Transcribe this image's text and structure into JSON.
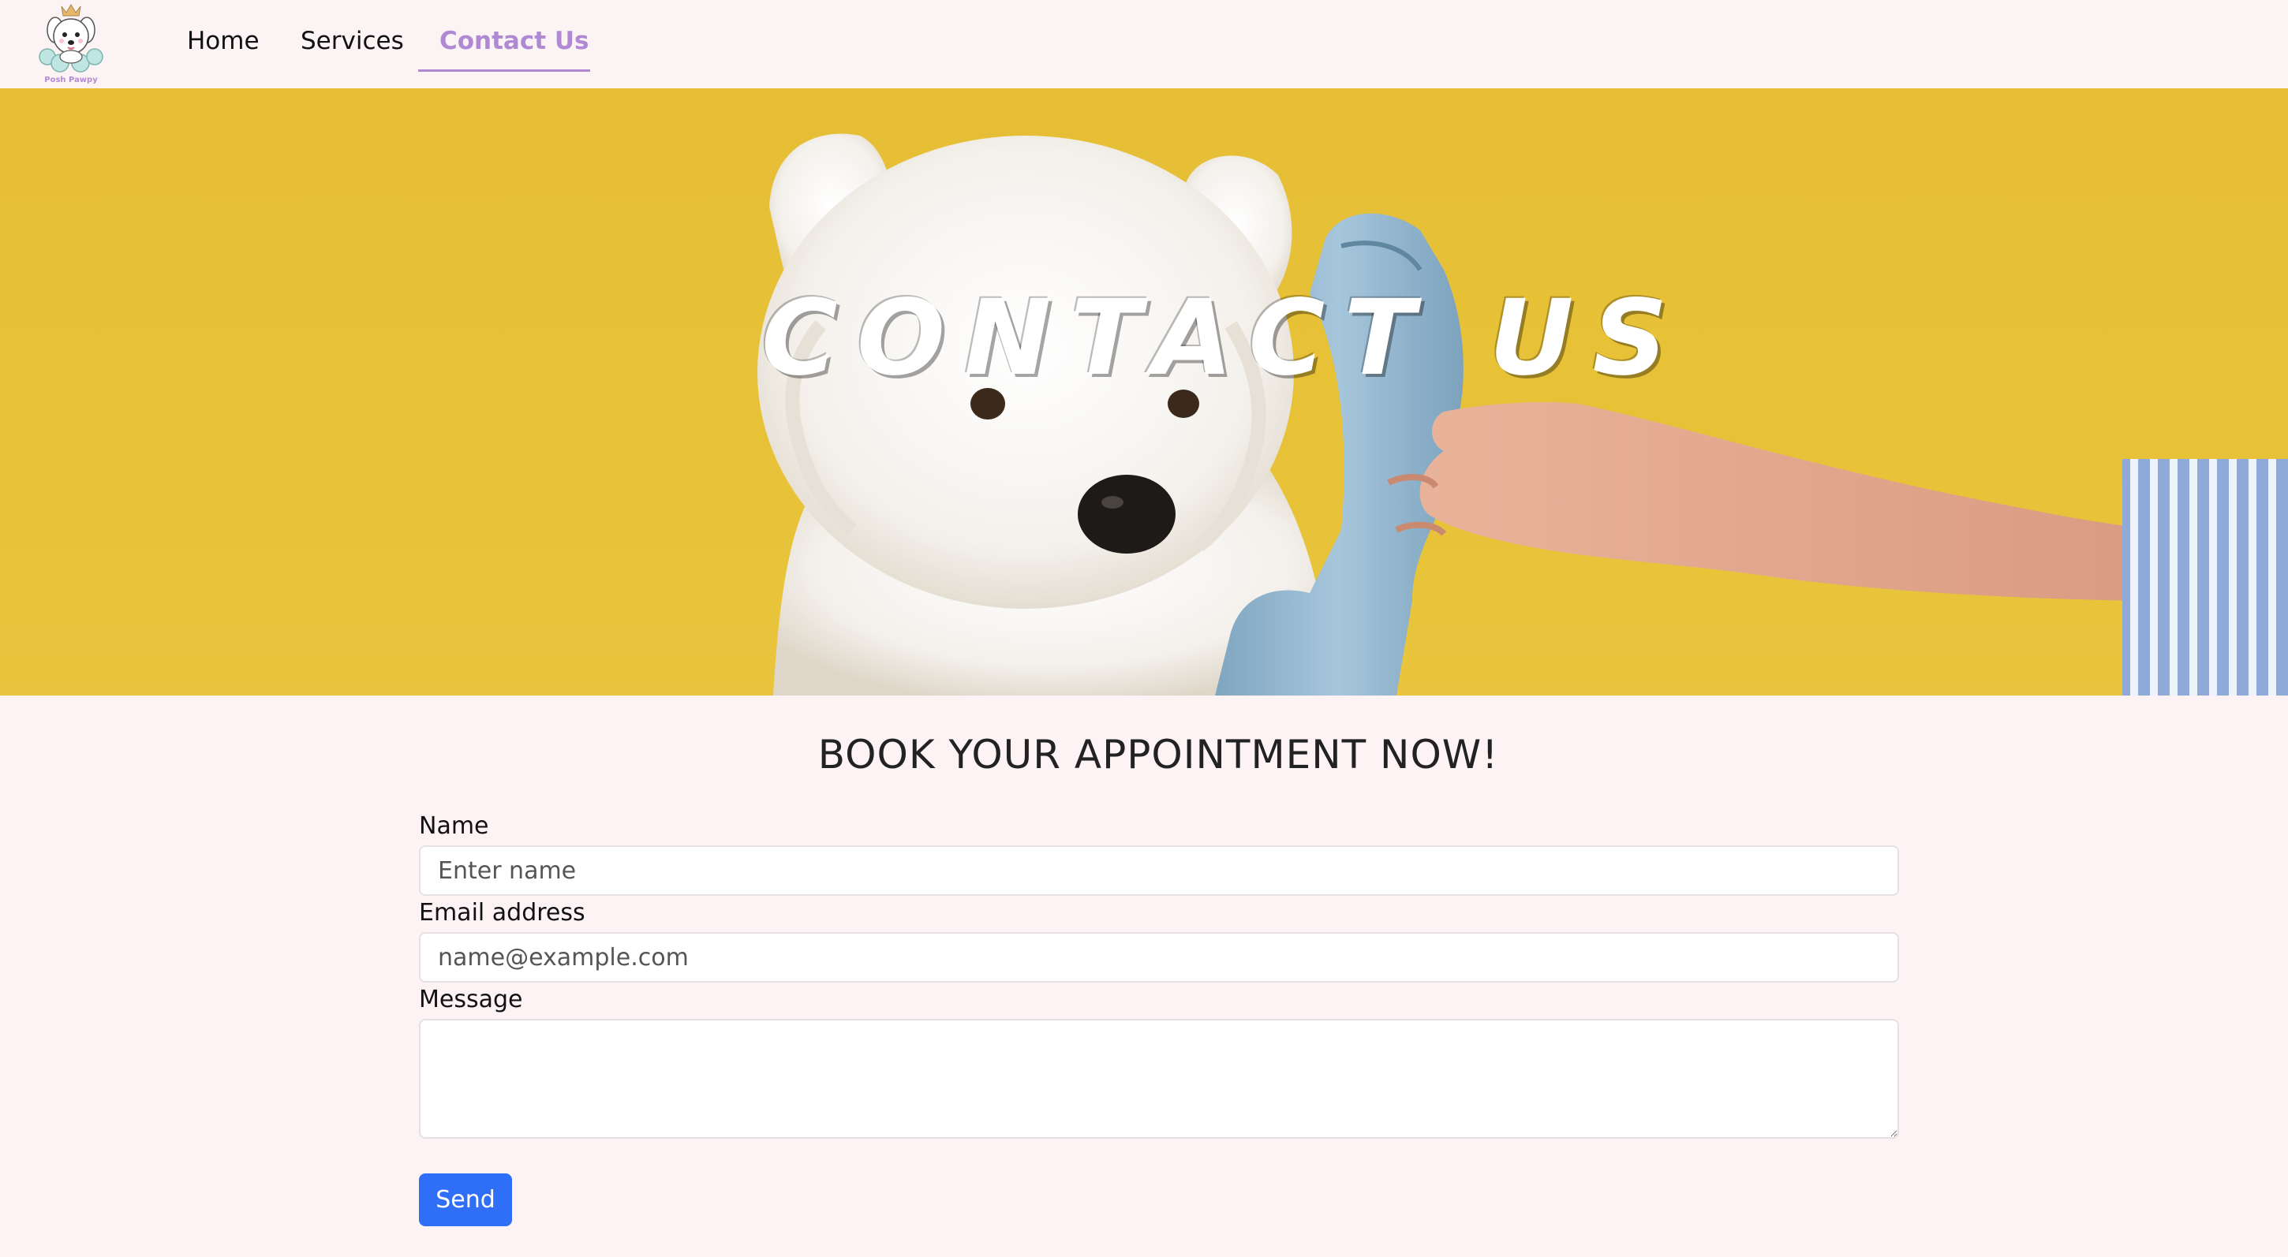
{
  "brand": {
    "logo_text": "Posh Pawpy",
    "accent": "#b089d3"
  },
  "nav": {
    "home": "Home",
    "services": "Services",
    "contact": "Contact Us"
  },
  "hero": {
    "title": "CONTACT US",
    "background": "#e6be35"
  },
  "form": {
    "heading": "BOOK YOUR APPOINTMENT NOW!",
    "name_label": "Name",
    "name_placeholder": "Enter name",
    "email_label": "Email address",
    "email_placeholder": "name@example.com",
    "message_label": "Message",
    "send_label": "Send",
    "button_color": "#2f6ef6"
  }
}
